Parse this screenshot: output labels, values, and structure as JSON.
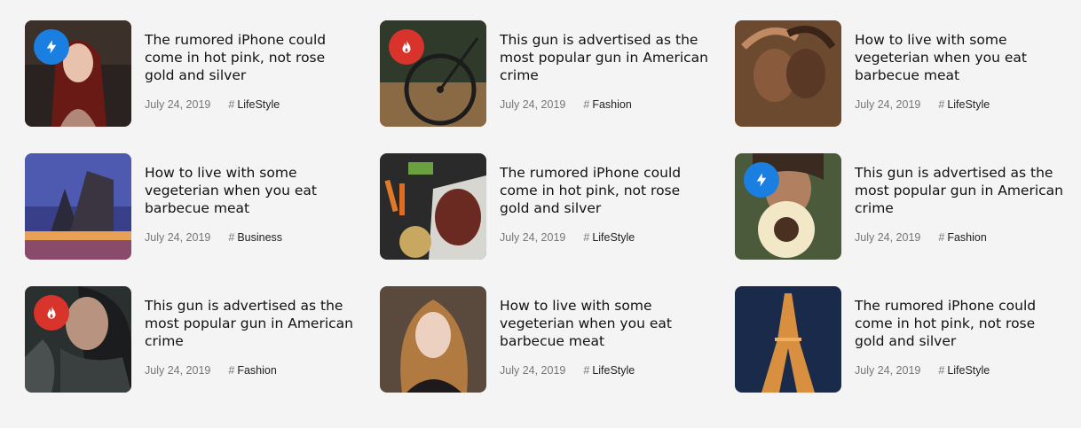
{
  "colors": {
    "badge_bolt": "#1a7fe0",
    "badge_flame": "#d9342b",
    "background": "#f4f4f4"
  },
  "posts": [
    {
      "title": "The rumored iPhone could come in hot pink, not rose gold and silver",
      "date": "July 24, 2019",
      "category": "LifeStyle",
      "badge": "bolt-icon",
      "image": "woman-red-hair"
    },
    {
      "title": "This gun is advertised as the most popular gun in American crime",
      "date": "July 24, 2019",
      "category": "Fashion",
      "badge": "flame-icon",
      "image": "bicycle-wheel"
    },
    {
      "title": "How to live with some vegeterian when you eat barbecue meat",
      "date": "July 24, 2019",
      "category": "LifeStyle",
      "badge": "",
      "image": "two-faces"
    },
    {
      "title": "How to live with some vegeterian when you eat barbecue meat",
      "date": "July 24, 2019",
      "category": "Business",
      "badge": "",
      "image": "modern-building-night"
    },
    {
      "title": "The rumored iPhone could come in hot pink, not rose gold and silver",
      "date": "July 24, 2019",
      "category": "LifeStyle",
      "badge": "",
      "image": "steak-vegetables"
    },
    {
      "title": "This gun is advertised as the most popular gun in American crime",
      "date": "July 24, 2019",
      "category": "Fashion",
      "badge": "bolt-icon",
      "image": "woman-sunflower"
    },
    {
      "title": "This gun is advertised as the most popular gun in American crime",
      "date": "July 24, 2019",
      "category": "Fashion",
      "badge": "flame-icon",
      "image": "tattooed-woman"
    },
    {
      "title": "How to live with some vegeterian when you eat barbecue meat",
      "date": "July 24, 2019",
      "category": "LifeStyle",
      "badge": "",
      "image": "blonde-woman"
    },
    {
      "title": "The rumored iPhone could come in hot pink, not rose gold and silver",
      "date": "July 24, 2019",
      "category": "LifeStyle",
      "badge": "",
      "image": "eiffel-tower-night"
    }
  ]
}
